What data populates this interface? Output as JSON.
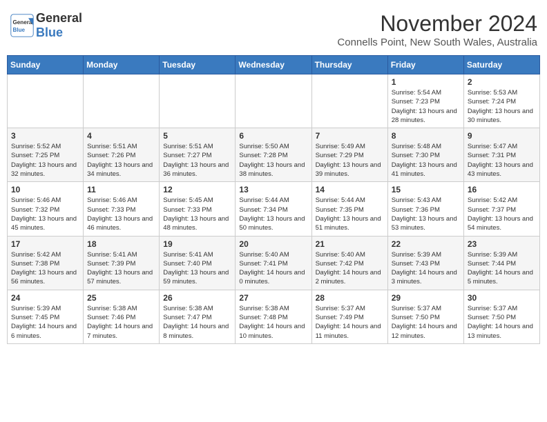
{
  "header": {
    "logo_general": "General",
    "logo_blue": "Blue",
    "month_title": "November 2024",
    "subtitle": "Connells Point, New South Wales, Australia"
  },
  "days_of_week": [
    "Sunday",
    "Monday",
    "Tuesday",
    "Wednesday",
    "Thursday",
    "Friday",
    "Saturday"
  ],
  "weeks": [
    [
      {
        "day": "",
        "detail": ""
      },
      {
        "day": "",
        "detail": ""
      },
      {
        "day": "",
        "detail": ""
      },
      {
        "day": "",
        "detail": ""
      },
      {
        "day": "",
        "detail": ""
      },
      {
        "day": "1",
        "detail": "Sunrise: 5:54 AM\nSunset: 7:23 PM\nDaylight: 13 hours and 28 minutes."
      },
      {
        "day": "2",
        "detail": "Sunrise: 5:53 AM\nSunset: 7:24 PM\nDaylight: 13 hours and 30 minutes."
      }
    ],
    [
      {
        "day": "3",
        "detail": "Sunrise: 5:52 AM\nSunset: 7:25 PM\nDaylight: 13 hours and 32 minutes."
      },
      {
        "day": "4",
        "detail": "Sunrise: 5:51 AM\nSunset: 7:26 PM\nDaylight: 13 hours and 34 minutes."
      },
      {
        "day": "5",
        "detail": "Sunrise: 5:51 AM\nSunset: 7:27 PM\nDaylight: 13 hours and 36 minutes."
      },
      {
        "day": "6",
        "detail": "Sunrise: 5:50 AM\nSunset: 7:28 PM\nDaylight: 13 hours and 38 minutes."
      },
      {
        "day": "7",
        "detail": "Sunrise: 5:49 AM\nSunset: 7:29 PM\nDaylight: 13 hours and 39 minutes."
      },
      {
        "day": "8",
        "detail": "Sunrise: 5:48 AM\nSunset: 7:30 PM\nDaylight: 13 hours and 41 minutes."
      },
      {
        "day": "9",
        "detail": "Sunrise: 5:47 AM\nSunset: 7:31 PM\nDaylight: 13 hours and 43 minutes."
      }
    ],
    [
      {
        "day": "10",
        "detail": "Sunrise: 5:46 AM\nSunset: 7:32 PM\nDaylight: 13 hours and 45 minutes."
      },
      {
        "day": "11",
        "detail": "Sunrise: 5:46 AM\nSunset: 7:33 PM\nDaylight: 13 hours and 46 minutes."
      },
      {
        "day": "12",
        "detail": "Sunrise: 5:45 AM\nSunset: 7:33 PM\nDaylight: 13 hours and 48 minutes."
      },
      {
        "day": "13",
        "detail": "Sunrise: 5:44 AM\nSunset: 7:34 PM\nDaylight: 13 hours and 50 minutes."
      },
      {
        "day": "14",
        "detail": "Sunrise: 5:44 AM\nSunset: 7:35 PM\nDaylight: 13 hours and 51 minutes."
      },
      {
        "day": "15",
        "detail": "Sunrise: 5:43 AM\nSunset: 7:36 PM\nDaylight: 13 hours and 53 minutes."
      },
      {
        "day": "16",
        "detail": "Sunrise: 5:42 AM\nSunset: 7:37 PM\nDaylight: 13 hours and 54 minutes."
      }
    ],
    [
      {
        "day": "17",
        "detail": "Sunrise: 5:42 AM\nSunset: 7:38 PM\nDaylight: 13 hours and 56 minutes."
      },
      {
        "day": "18",
        "detail": "Sunrise: 5:41 AM\nSunset: 7:39 PM\nDaylight: 13 hours and 57 minutes."
      },
      {
        "day": "19",
        "detail": "Sunrise: 5:41 AM\nSunset: 7:40 PM\nDaylight: 13 hours and 59 minutes."
      },
      {
        "day": "20",
        "detail": "Sunrise: 5:40 AM\nSunset: 7:41 PM\nDaylight: 14 hours and 0 minutes."
      },
      {
        "day": "21",
        "detail": "Sunrise: 5:40 AM\nSunset: 7:42 PM\nDaylight: 14 hours and 2 minutes."
      },
      {
        "day": "22",
        "detail": "Sunrise: 5:39 AM\nSunset: 7:43 PM\nDaylight: 14 hours and 3 minutes."
      },
      {
        "day": "23",
        "detail": "Sunrise: 5:39 AM\nSunset: 7:44 PM\nDaylight: 14 hours and 5 minutes."
      }
    ],
    [
      {
        "day": "24",
        "detail": "Sunrise: 5:39 AM\nSunset: 7:45 PM\nDaylight: 14 hours and 6 minutes."
      },
      {
        "day": "25",
        "detail": "Sunrise: 5:38 AM\nSunset: 7:46 PM\nDaylight: 14 hours and 7 minutes."
      },
      {
        "day": "26",
        "detail": "Sunrise: 5:38 AM\nSunset: 7:47 PM\nDaylight: 14 hours and 8 minutes."
      },
      {
        "day": "27",
        "detail": "Sunrise: 5:38 AM\nSunset: 7:48 PM\nDaylight: 14 hours and 10 minutes."
      },
      {
        "day": "28",
        "detail": "Sunrise: 5:37 AM\nSunset: 7:49 PM\nDaylight: 14 hours and 11 minutes."
      },
      {
        "day": "29",
        "detail": "Sunrise: 5:37 AM\nSunset: 7:50 PM\nDaylight: 14 hours and 12 minutes."
      },
      {
        "day": "30",
        "detail": "Sunrise: 5:37 AM\nSunset: 7:50 PM\nDaylight: 14 hours and 13 minutes."
      }
    ]
  ]
}
